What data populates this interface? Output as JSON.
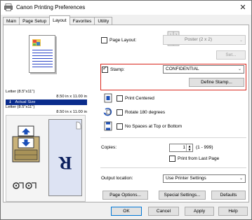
{
  "window": {
    "title": "Canon Printing Preferences",
    "close_glyph": "✕"
  },
  "tabs": [
    {
      "label": "Main",
      "active": false
    },
    {
      "label": "Page Setup",
      "active": false
    },
    {
      "label": "Layout",
      "active": true
    },
    {
      "label": "Favorites",
      "active": false
    },
    {
      "label": "Utility",
      "active": false
    }
  ],
  "preview": {
    "paper_line1": "Letter (8.5\"x11\")",
    "paper_line1_size": "8.50 in x 11.00 in",
    "actual_size_label": "Actual Size",
    "paper_line2": "Letter (8.5\"x11\")",
    "paper_line2_size": "8.50 in x 11.00 in",
    "stamp_letter": "R"
  },
  "layout": {
    "page_layout_label": "Page Layout:",
    "page_layout_checked": false,
    "page_layout_value": "Poster (2 x 2)",
    "set_button": "Set..."
  },
  "stamp": {
    "label": "Stamp:",
    "checked": true,
    "value": "CONFIDENTIAL",
    "define_button": "Define Stamp..."
  },
  "options": {
    "print_centered": "Print Centered",
    "rotate": "Rotate 180 degrees",
    "no_spaces": "No Spaces at Top or Bottom"
  },
  "copies": {
    "label": "Copies:",
    "value": "1",
    "range": "(1 - 999)",
    "print_from_last": "Print from Last Page"
  },
  "output": {
    "label": "Output location:",
    "value": "Use Printer Settings"
  },
  "bottom_buttons": {
    "page_options": "Page Options...",
    "special_settings": "Special Settings...",
    "defaults": "Defaults"
  },
  "dialog_buttons": {
    "ok": "OK",
    "cancel": "Cancel",
    "apply": "Apply",
    "help": "Help"
  },
  "colors": {
    "highlight": "#d9261c",
    "actual_size_bg": "#0a2c8c",
    "stamp_preview_bg": "#dde3f3"
  }
}
